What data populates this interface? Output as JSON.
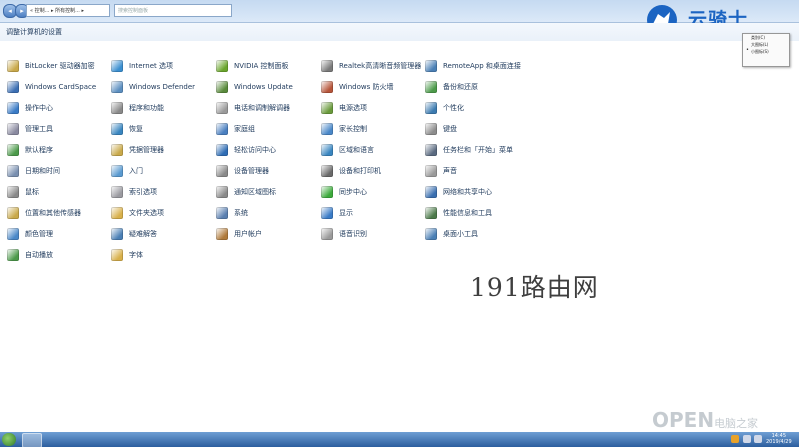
{
  "address": {
    "path": "« 控制... ▸ 所有控制... ▸"
  },
  "search": {
    "placeholder": "搜索控制面板"
  },
  "page_title": "调整计算机的设置",
  "logo_text": "云骑士",
  "view_menu": [
    {
      "label": "类别(C)",
      "selected": false
    },
    {
      "label": "大图标(L)",
      "selected": false
    },
    {
      "label": "小图标(S)",
      "selected": true
    }
  ],
  "items": [
    {
      "label": "BitLocker 驱动器加密",
      "color": "#c9a94a"
    },
    {
      "label": "Internet 选项",
      "color": "#3b8fd0"
    },
    {
      "label": "NVIDIA 控制面板",
      "color": "#6aa52c"
    },
    {
      "label": "Realtek高清晰音频管理器",
      "color": "#7a7a7a"
    },
    {
      "label": "RemoteApp 和桌面连接",
      "color": "#4a7fb5"
    },
    {
      "label": "Windows CardSpace",
      "color": "#3c6fb3"
    },
    {
      "label": "Windows Defender",
      "color": "#5c8fc0"
    },
    {
      "label": "Windows Update",
      "color": "#5a8a3c"
    },
    {
      "label": "Windows 防火墙",
      "color": "#b6553a"
    },
    {
      "label": "备份和还原",
      "color": "#4c9a4a"
    },
    {
      "label": "操作中心",
      "color": "#3a7bc6"
    },
    {
      "label": "程序和功能",
      "color": "#8a8a8a"
    },
    {
      "label": "电话和调制解调器",
      "color": "#9a9a9a"
    },
    {
      "label": "电源选项",
      "color": "#6a9a3c"
    },
    {
      "label": "个性化",
      "color": "#3c7bb0"
    },
    {
      "label": "管理工具",
      "color": "#8a8aa0"
    },
    {
      "label": "恢复",
      "color": "#3a86c0"
    },
    {
      "label": "家庭组",
      "color": "#4a7fc0"
    },
    {
      "label": "家长控制",
      "color": "#4a88c8"
    },
    {
      "label": "键盘",
      "color": "#8c8c8c"
    },
    {
      "label": "默认程序",
      "color": "#4c9a4a"
    },
    {
      "label": "凭据管理器",
      "color": "#c9a94a"
    },
    {
      "label": "轻松访问中心",
      "color": "#2f6db5"
    },
    {
      "label": "区域和语言",
      "color": "#3a86c0"
    },
    {
      "label": "任务栏和「开始」菜单",
      "color": "#5a6a80"
    },
    {
      "label": "日期和时间",
      "color": "#7a90b0"
    },
    {
      "label": "入门",
      "color": "#5a9ad0"
    },
    {
      "label": "设备管理器",
      "color": "#8a8a8a"
    },
    {
      "label": "设备和打印机",
      "color": "#6a6a6a"
    },
    {
      "label": "声音",
      "color": "#9a9a9a"
    },
    {
      "label": "鼠标",
      "color": "#8a8a8a"
    },
    {
      "label": "索引选项",
      "color": "#9a9aa0"
    },
    {
      "label": "通知区域图标",
      "color": "#8a8a8a"
    },
    {
      "label": "同步中心",
      "color": "#3caa3c"
    },
    {
      "label": "网络和共享中心",
      "color": "#3a6fb0"
    },
    {
      "label": "位置和其他传感器",
      "color": "#c9a94a"
    },
    {
      "label": "文件夹选项",
      "color": "#d8b04a"
    },
    {
      "label": "系统",
      "color": "#5a7fb0"
    },
    {
      "label": "显示",
      "color": "#3a7bc6"
    },
    {
      "label": "性能信息和工具",
      "color": "#4c7a4a"
    },
    {
      "label": "颜色管理",
      "color": "#4a88c8"
    },
    {
      "label": "疑难解答",
      "color": "#4a7fb5"
    },
    {
      "label": "用户帐户",
      "color": "#b07a3a"
    },
    {
      "label": "语音识别",
      "color": "#9a9a9a"
    },
    {
      "label": "桌面小工具",
      "color": "#4a7fb5"
    },
    {
      "label": "自动播放",
      "color": "#4c9a4a"
    },
    {
      "label": "字体",
      "color": "#d8b04a"
    }
  ],
  "watermark": "191路由网",
  "watermark_open": "OPEN",
  "watermark_open_suffix": "电脑之家",
  "clock": {
    "time": "14:45",
    "date": "2019/4/29"
  }
}
